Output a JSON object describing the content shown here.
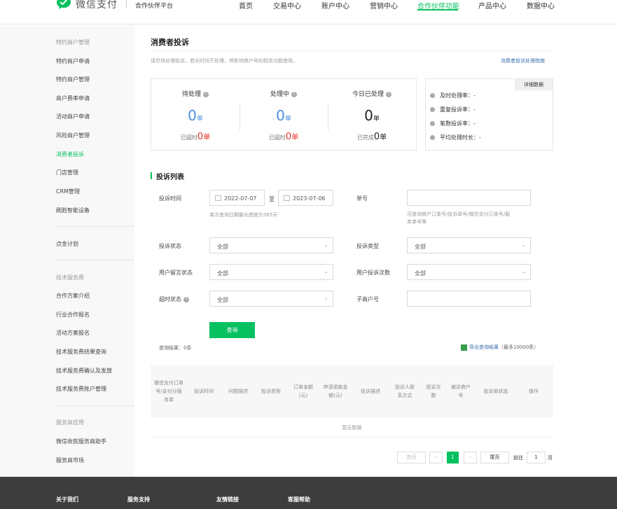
{
  "header": {
    "logo_text": "微信支付",
    "logo_sub": "合作伙伴平台",
    "nav": [
      "首页",
      "交易中心",
      "账户中心",
      "营销中心",
      "合作伙伴功能",
      "产品中心",
      "数据中心"
    ],
    "active_nav": "合作伙伴功能"
  },
  "sidebar": {
    "group1_title": "特约商户管理",
    "group1": [
      "特约商户申请",
      "特约商户管理",
      "商户费率申请",
      "活动商户申请",
      "风险商户管理",
      "消费者投诉",
      "门店管理",
      "CRM管理",
      "刷脸智能设备"
    ],
    "active": "消费者投诉",
    "group2": [
      "点金计划"
    ],
    "group3_title": "技术服务费",
    "group3": [
      "合作方案介绍",
      "行业合作报名",
      "活动方案报名",
      "技术服务费结果查询",
      "技术服务费确认及发放",
      "技术服务费账户管理"
    ],
    "group4_title": "服务商应用",
    "group4": [
      "微信收款服务商助手",
      "服务商市场"
    ]
  },
  "main": {
    "title": "消费者投诉",
    "desc": "请尽快处理投诉。若长时间不处理，将影响商户号的相关功能使用。",
    "guide_link": "消费者投诉处理指南",
    "stats": [
      {
        "label": "待处理",
        "value": "0",
        "unit": "单",
        "sub_label": "已超时",
        "sub_value": "0",
        "sub_unit": "单"
      },
      {
        "label": "处理中",
        "value": "0",
        "unit": "单",
        "sub_label": "已超时",
        "sub_value": "0",
        "sub_unit": "单"
      },
      {
        "label": "今日已处理",
        "value": "0",
        "unit": "单",
        "sub_label": "已完成",
        "sub_value": "0",
        "sub_unit": "单"
      }
    ],
    "rates": [
      "及时处理率：-",
      "重复投诉率：-",
      "笔数投诉率：-",
      "平均处理时长：-"
    ],
    "detail_btn": "详细数据",
    "list_title": "投诉列表",
    "form": {
      "time_label": "投诉时间",
      "date_start": "2022-07-07",
      "date_sep": "至",
      "date_end": "2023-07-06",
      "date_hint": "单次查询日期最长跨度为365天",
      "order_label": "单号",
      "order_value": "",
      "order_hint_1": "可查询商户订单号/投诉单号/微信支付订单号/服",
      "order_hint_2": "务单号等",
      "status_label": "投诉状态",
      "status_value": "全部",
      "type_label": "投诉类型",
      "type_value": "全部",
      "msg_label": "用户留言状态",
      "msg_value": "全部",
      "count_label": "用户投诉次数",
      "count_value": "全部",
      "timeout_label": "超时状态",
      "timeout_value": "全部",
      "sub_label": "子商户号",
      "sub_value": ""
    },
    "query_btn": "查询",
    "result_count": "查询结果：0条",
    "export_link": "导出查询结果",
    "export_note": "（最多10000条）",
    "table_headers": [
      "微信支付订单号/支付分服务单",
      "投诉时间",
      "问题描述",
      "投诉类型",
      "订单金额(元)",
      "申请退款金额(元)",
      "投诉描述",
      "投诉人联系方式",
      "投诉次数",
      "被诉商户号",
      "投诉单状态",
      "操作"
    ],
    "table_empty": "暂无数据",
    "pagination": {
      "first": "首页",
      "prev": "‹",
      "current": "1",
      "next": "›",
      "last": "尾页",
      "goto_label": "前往",
      "goto_value": "1",
      "page_label": "页"
    }
  },
  "footer": [
    "关于我们",
    "服务支持",
    "友情链接",
    "客服帮助"
  ],
  "colors": {
    "brand": "#07c160",
    "link": "#3a6fb0",
    "danger": "#e0342f",
    "stat_blue": "#4a90d9"
  }
}
